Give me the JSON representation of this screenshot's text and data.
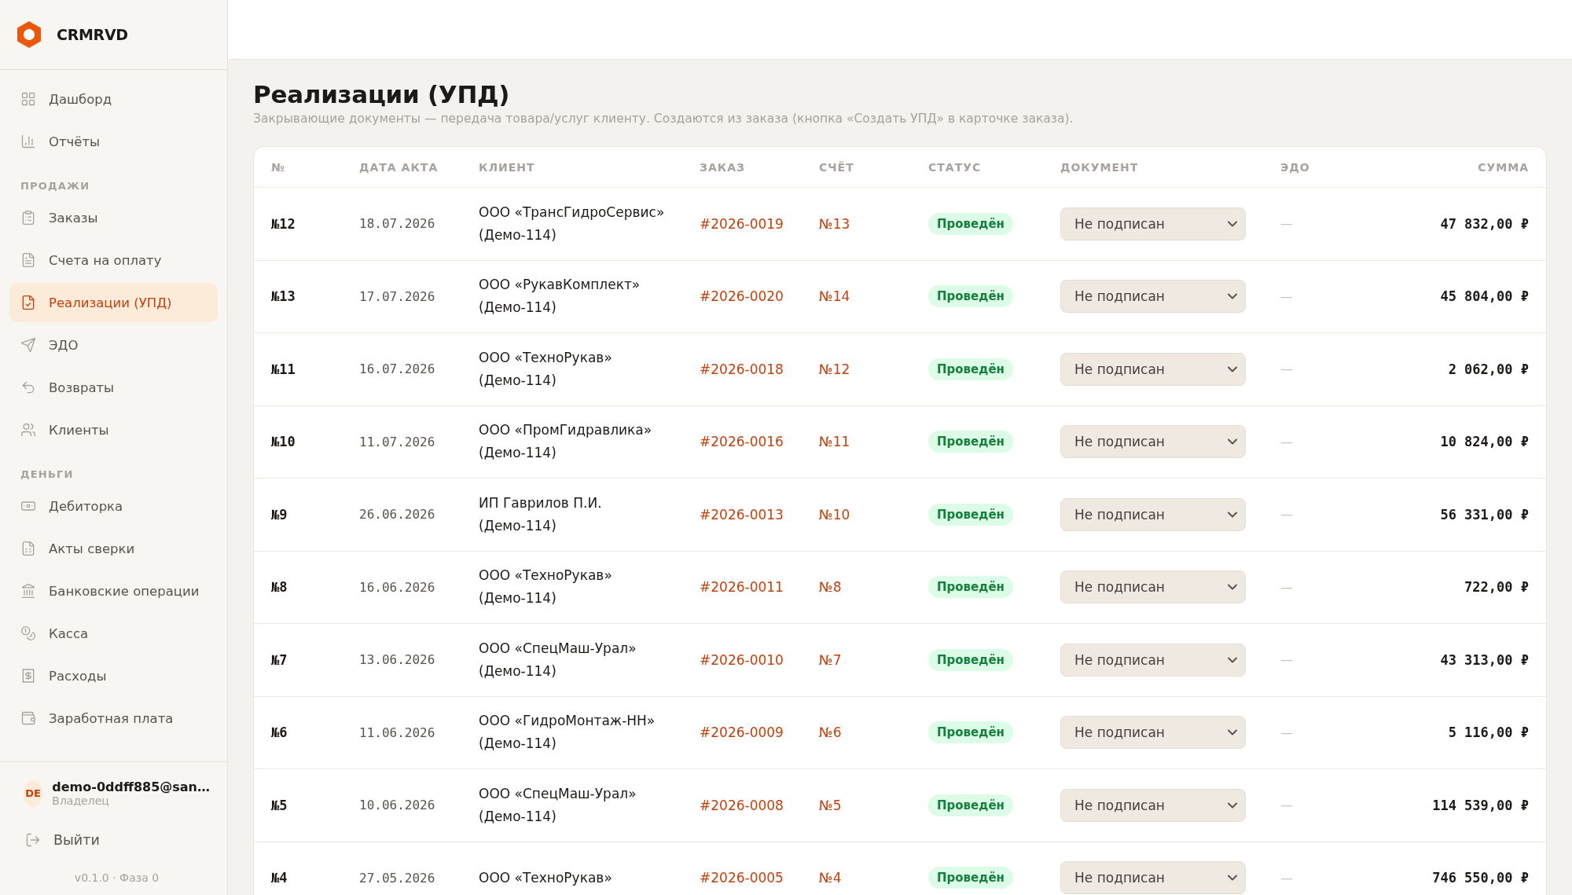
{
  "brand": {
    "name": "CRMRVD"
  },
  "sidebar": {
    "sections": [
      {
        "items": [
          {
            "label": "Дашборд",
            "selected": false
          },
          {
            "label": "Отчёты",
            "selected": false
          }
        ]
      },
      {
        "title": "ПРОДАЖИ",
        "items": [
          {
            "label": "Заказы",
            "selected": false
          },
          {
            "label": "Счета на оплату",
            "selected": false
          },
          {
            "label": "Реализации (УПД)",
            "selected": true
          },
          {
            "label": "ЭДО",
            "selected": false
          },
          {
            "label": "Возвраты",
            "selected": false
          },
          {
            "label": "Клиенты",
            "selected": false
          }
        ]
      },
      {
        "title": "ДЕНЬГИ",
        "items": [
          {
            "label": "Дебиторка",
            "selected": false
          },
          {
            "label": "Акты сверки",
            "selected": false
          },
          {
            "label": "Банковские операции",
            "selected": false
          },
          {
            "label": "Касса",
            "selected": false
          },
          {
            "label": "Расходы",
            "selected": false
          },
          {
            "label": "Заработная плата",
            "selected": false
          }
        ]
      }
    ],
    "user": {
      "initials": "DE",
      "email": "demo-0ddff885@san…",
      "role": "Владелец"
    },
    "logout": "Выйти",
    "version": "v0.1.0 · Фаза 0"
  },
  "page": {
    "title": "Реализации (УПД)",
    "subtitle": "Закрывающие документы — передача товара/услуг клиенту. Создаются из заказа (кнопка «Создать УПД» в карточке заказа)."
  },
  "table": {
    "columns": [
      "№",
      "ДАТА АКТА",
      "КЛИЕНТ",
      "ЗАКАЗ",
      "СЧЁТ",
      "СТАТУС",
      "ДОКУМЕНТ",
      "ЭДО",
      "СУММА"
    ],
    "rows": [
      {
        "number": "№12",
        "date": "18.07.2026",
        "client": "ООО «ТрансГидроСервис»",
        "client_note": "(Демо-114)",
        "order": "#2026-0019",
        "invoice": "№13",
        "status": {
          "label": "Проведён",
          "kind": "posted"
        },
        "document": "Не подписан",
        "edo": "—",
        "sum": "47 832,00 ₽"
      },
      {
        "number": "№13",
        "date": "17.07.2026",
        "client": "ООО «РукавКомплект»",
        "client_note": "(Демо-114)",
        "order": "#2026-0020",
        "invoice": "№14",
        "status": {
          "label": "Проведён",
          "kind": "posted"
        },
        "document": "Не подписан",
        "edo": "—",
        "sum": "45 804,00 ₽"
      },
      {
        "number": "№11",
        "date": "16.07.2026",
        "client": "ООО «ТехноРукав»",
        "client_note": "(Демо-114)",
        "order": "#2026-0018",
        "invoice": "№12",
        "status": {
          "label": "Проведён",
          "kind": "posted"
        },
        "document": "Не подписан",
        "edo": "—",
        "sum": "2 062,00 ₽"
      },
      {
        "number": "№10",
        "date": "11.07.2026",
        "client": "ООО «ПромГидравлика»",
        "client_note": "(Демо-114)",
        "order": "#2026-0016",
        "invoice": "№11",
        "status": {
          "label": "Проведён",
          "kind": "posted"
        },
        "document": "Не подписан",
        "edo": "—",
        "sum": "10 824,00 ₽"
      },
      {
        "number": "№9",
        "date": "26.06.2026",
        "client": "ИП Гаврилов П.И.",
        "client_note": "(Демо-114)",
        "order": "#2026-0013",
        "invoice": "№10",
        "status": {
          "label": "Проведён",
          "kind": "posted"
        },
        "document": "Не подписан",
        "edo": "—",
        "sum": "56 331,00 ₽"
      },
      {
        "number": "№8",
        "date": "16.06.2026",
        "client": "ООО «ТехноРукав»",
        "client_note": "(Демо-114)",
        "order": "#2026-0011",
        "invoice": "№8",
        "status": {
          "label": "Проведён",
          "kind": "posted"
        },
        "document": "Не подписан",
        "edo": "—",
        "sum": "722,00 ₽"
      },
      {
        "number": "№7",
        "date": "13.06.2026",
        "client": "ООО «СпецМаш-Урал»",
        "client_note": "(Демо-114)",
        "order": "#2026-0010",
        "invoice": "№7",
        "status": {
          "label": "Проведён",
          "kind": "posted"
        },
        "document": "Не подписан",
        "edo": "—",
        "sum": "43 313,00 ₽"
      },
      {
        "number": "№6",
        "date": "11.06.2026",
        "client": "ООО «ГидроМонтаж-НН»",
        "client_note": "(Демо-114)",
        "order": "#2026-0009",
        "invoice": "№6",
        "status": {
          "label": "Проведён",
          "kind": "posted"
        },
        "document": "Не подписан",
        "edo": "—",
        "sum": "5 116,00 ₽"
      },
      {
        "number": "№5",
        "date": "10.06.2026",
        "client": "ООО «СпецМаш-Урал»",
        "client_note": "(Демо-114)",
        "order": "#2026-0008",
        "invoice": "№5",
        "status": {
          "label": "Проведён",
          "kind": "posted"
        },
        "document": "Не подписан",
        "edo": "—",
        "sum": "114 539,00 ₽"
      },
      {
        "number": "№4",
        "date": "27.05.2026",
        "client": "ООО «ТехноРукав»",
        "order": "#2026-0005",
        "invoice": "№4",
        "status": {
          "label": "Проведён",
          "kind": "posted"
        },
        "document": "Не подписан",
        "edo": "—",
        "sum": "746 550,00 ₽"
      }
    ]
  }
}
